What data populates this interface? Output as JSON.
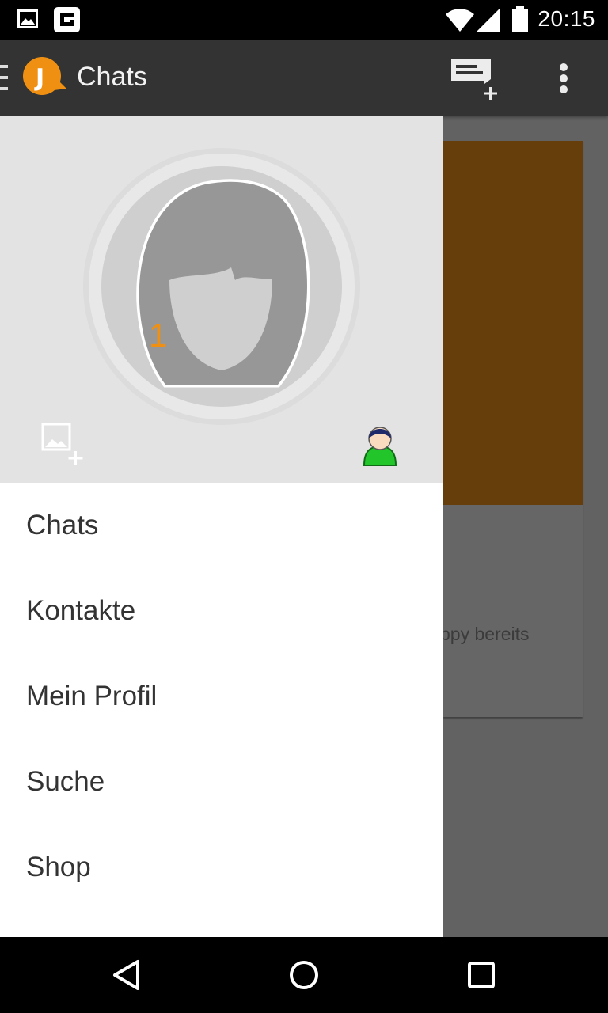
{
  "status_bar": {
    "time": "20:15",
    "icons": [
      "image-notification-icon",
      "app-notification-icon",
      "wifi-icon",
      "cell-signal-icon",
      "battery-icon"
    ]
  },
  "action_bar": {
    "title": "Chats",
    "icons": [
      "drawer-toggle-icon",
      "app-logo",
      "new-chat-icon",
      "overflow-menu-icon"
    ],
    "logo_letter": "J"
  },
  "background": {
    "snippet_text": "ppy bereits"
  },
  "drawer": {
    "profile": {
      "badge_number": "1",
      "icons": [
        "default-avatar-icon",
        "add-picture-icon",
        "user-status-icon"
      ]
    },
    "items": [
      {
        "label": "Chats"
      },
      {
        "label": "Kontakte"
      },
      {
        "label": "Mein Profil"
      },
      {
        "label": "Suche"
      },
      {
        "label": "Shop"
      }
    ]
  },
  "nav_bar": {
    "icons": [
      "back-icon",
      "home-icon",
      "recents-icon"
    ]
  },
  "colors": {
    "status_bar": "#000000",
    "action_bar": "#333333",
    "drawer_header": "#e3e3e3",
    "accent_orange": "#f09013",
    "bg_image": "#653e0b",
    "scrim": "#626262"
  }
}
